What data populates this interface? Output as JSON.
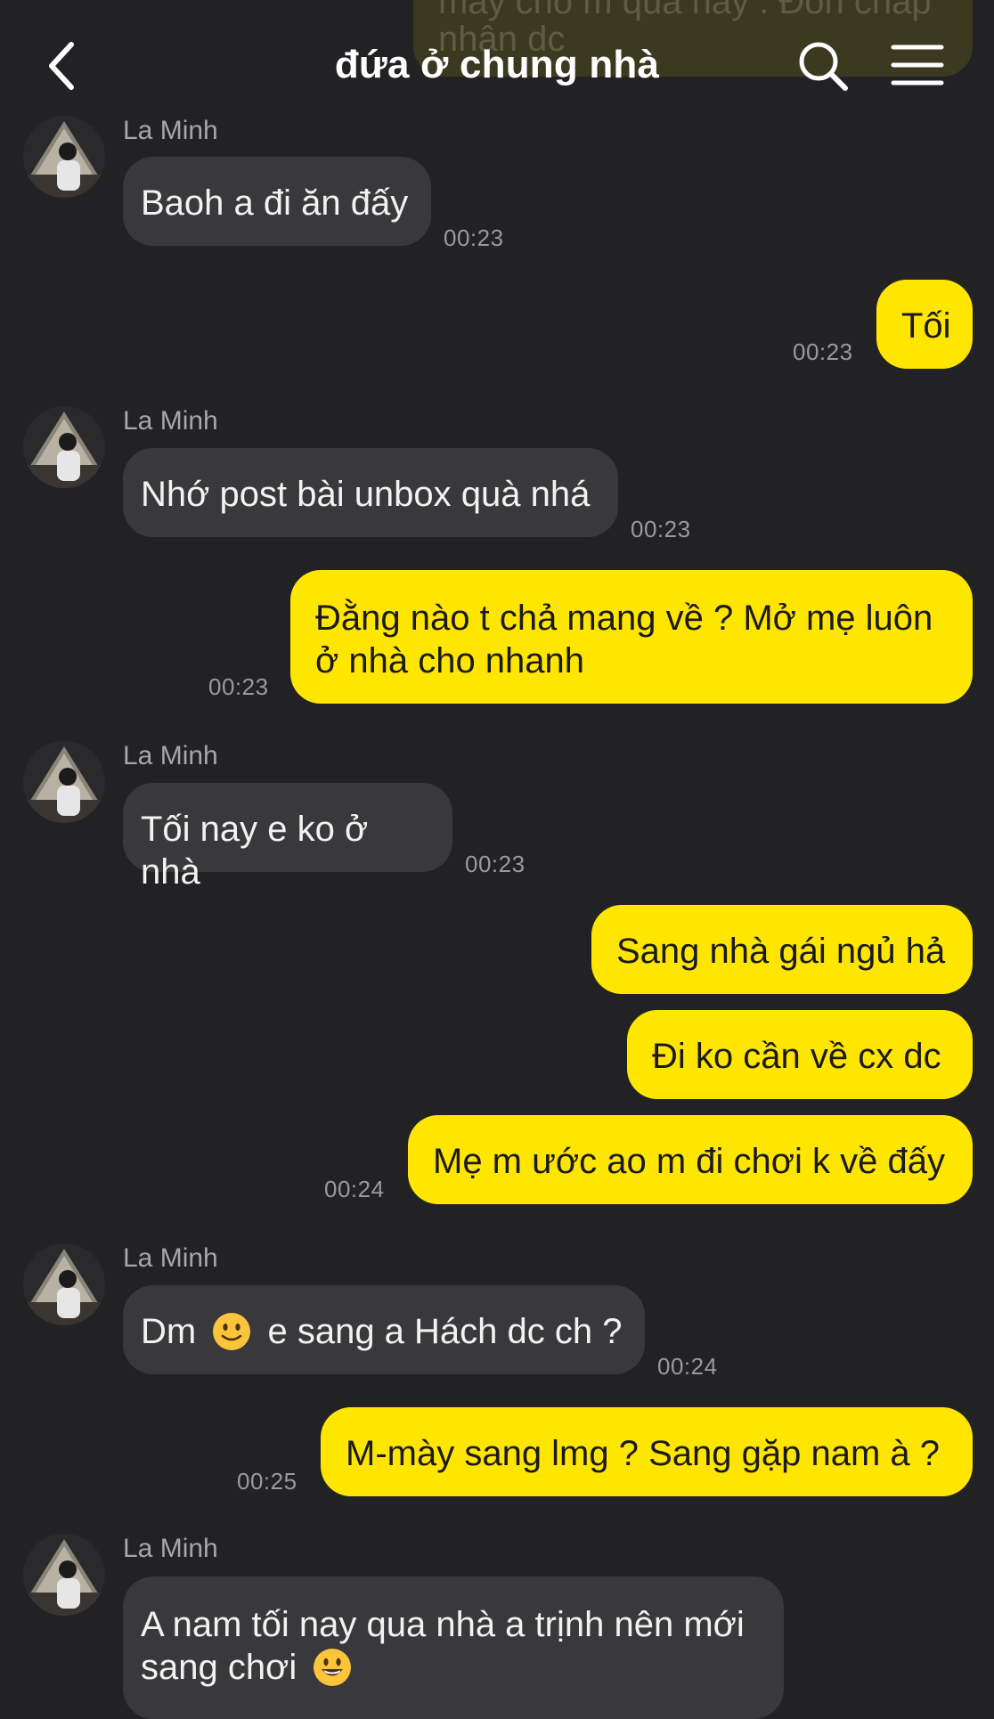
{
  "header": {
    "title": "đứa ở chung nhà",
    "back_icon": "chevron-left-icon",
    "search_icon": "search-icon",
    "menu_icon": "menu-icon"
  },
  "colors": {
    "background": "#222224",
    "incoming_bubble": "#39393b",
    "outgoing_bubble": "#ffe600",
    "timestamp": "#9a9a9d"
  },
  "top_partial": {
    "line1": "máy cho m quà này . Đồn chấp",
    "line2": "nhận dc"
  },
  "messages": [
    {
      "direction": "in",
      "sender": "La Minh",
      "text": "Baoh a đi ăn đấy",
      "time": "00:23"
    },
    {
      "direction": "out",
      "text": "Tối",
      "time": "00:23"
    },
    {
      "direction": "in",
      "sender": "La Minh",
      "text": "Nhớ post bài unbox quà nhá",
      "time": "00:23"
    },
    {
      "direction": "out",
      "line1": "Đằng nào t chả mang về ? Mở mẹ luôn",
      "line2": "ở nhà cho nhanh",
      "time": "00:23"
    },
    {
      "direction": "in",
      "sender": "La Minh",
      "text": "Tối nay e ko ở nhà",
      "time": "00:23"
    },
    {
      "direction": "out",
      "text": "Sang nhà gái ngủ hả"
    },
    {
      "direction": "out",
      "text": "Đi ko cần về cx dc"
    },
    {
      "direction": "out",
      "text": "Mẹ m ước ao m đi chơi k về đấy",
      "time": "00:24"
    },
    {
      "direction": "in",
      "sender": "La Minh",
      "text_before": "Dm",
      "emoji": "slightly-smiling-face-icon",
      "text_after": "e sang a Hách dc ch ?",
      "time": "00:24"
    },
    {
      "direction": "out",
      "text": "M-mày sang lmg ? Sang gặp nam à ?",
      "time": "00:25"
    },
    {
      "direction": "in",
      "sender": "La Minh",
      "line1": "A nam tối nay qua nhà a trịnh nên mới",
      "line2_text": "sang chơi",
      "emoji": "grinning-face-icon"
    }
  ]
}
